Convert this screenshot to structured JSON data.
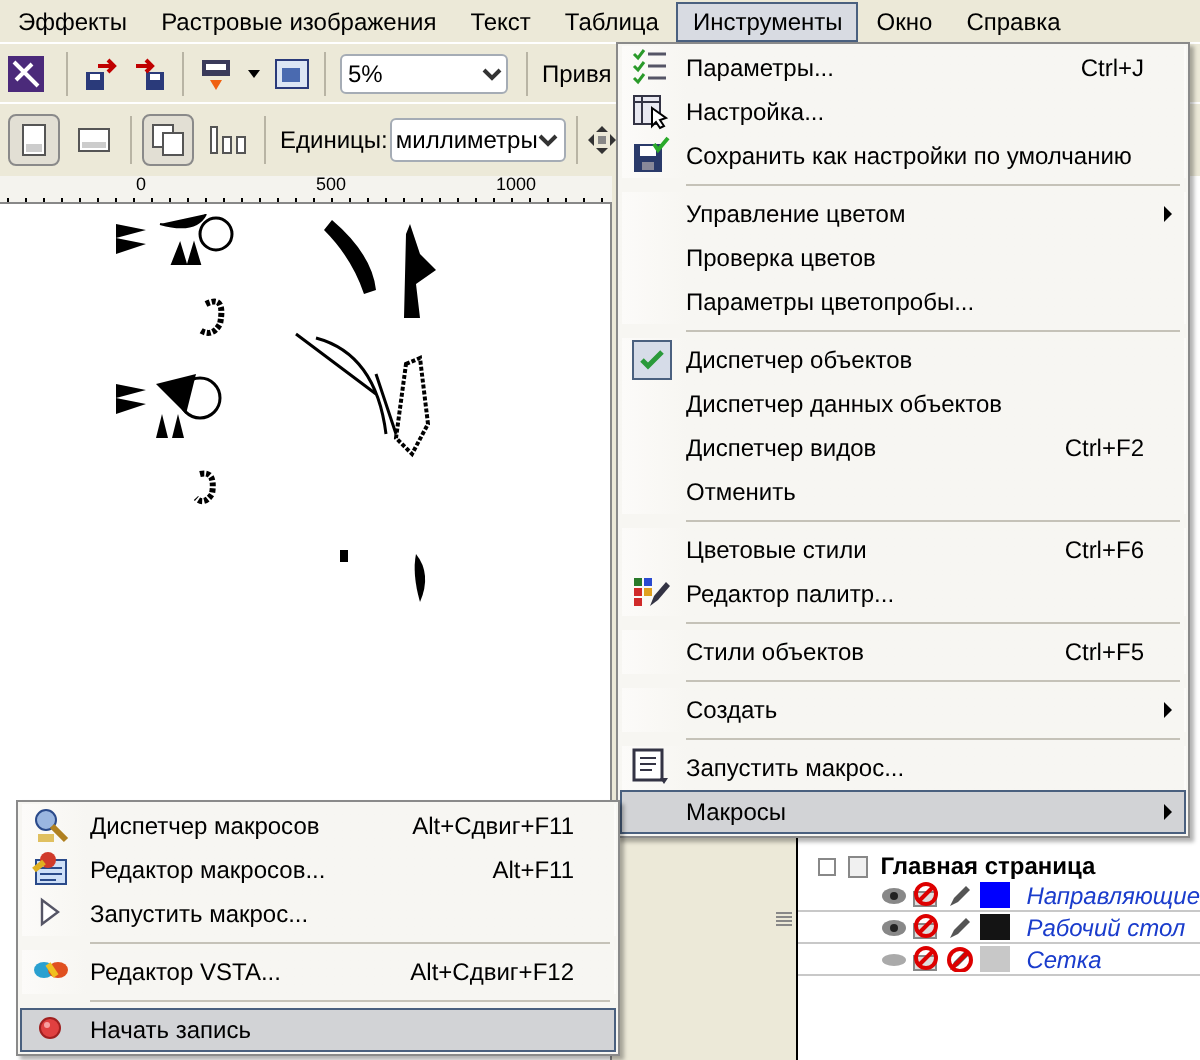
{
  "menubar": [
    {
      "label": "Эффекты",
      "selected": false
    },
    {
      "label": "Растровые изображения",
      "selected": false
    },
    {
      "label": "Текст",
      "selected": false
    },
    {
      "label": "Таблица",
      "selected": false
    },
    {
      "label": "Инструменты",
      "selected": true
    },
    {
      "label": "Окно",
      "selected": false
    },
    {
      "label": "Справка",
      "selected": false
    }
  ],
  "toolbar": {
    "zoom_combo": "5%",
    "snap_label": "Привя"
  },
  "property_bar": {
    "orientation_buttons": [
      {
        "selected": true
      },
      {
        "selected": false
      }
    ],
    "page_buttons": [
      {
        "selected": true
      },
      {
        "selected": false
      }
    ],
    "units_label": "Единицы:",
    "units_combo": "миллиметры"
  },
  "ruler": {
    "labels": [
      "0",
      "500",
      "1000"
    ]
  },
  "object_manager": {
    "page": "Главная страница",
    "layers": [
      {
        "name": "Направляющие",
        "color": "#0000ff",
        "visible": true,
        "editable": true
      },
      {
        "name": "Рабочий стол",
        "color": "#141414",
        "visible": true,
        "editable": true
      },
      {
        "name": "Сетка",
        "color": "#c8c8c8",
        "visible": false,
        "editable": false
      }
    ]
  },
  "tools_menu": {
    "items": [
      {
        "kind": "item",
        "label": "Параметры...",
        "shortcut": "Ctrl+J",
        "checked": false,
        "submenu": false,
        "selected": false
      },
      {
        "kind": "item",
        "label": "Настройка...",
        "checked": false,
        "submenu": false,
        "selected": false
      },
      {
        "kind": "item",
        "label": "Сохранить как настройки по умолчанию",
        "checked": false,
        "submenu": false,
        "selected": false
      },
      {
        "kind": "separator"
      },
      {
        "kind": "item",
        "label": "Управление цветом",
        "checked": false,
        "submenu": true,
        "selected": false
      },
      {
        "kind": "item",
        "label": "Проверка цветов",
        "checked": false,
        "submenu": false,
        "selected": false
      },
      {
        "kind": "item",
        "label": "Параметры цветопробы...",
        "checked": false,
        "submenu": false,
        "selected": false
      },
      {
        "kind": "separator"
      },
      {
        "kind": "item",
        "label": "Диспетчер объектов",
        "checked": true,
        "submenu": false,
        "selected": false
      },
      {
        "kind": "item",
        "label": "Диспетчер данных объектов",
        "checked": false,
        "submenu": false,
        "selected": false
      },
      {
        "kind": "item",
        "label": "Диспетчер видов",
        "shortcut": "Ctrl+F2",
        "checked": false,
        "submenu": false,
        "selected": false
      },
      {
        "kind": "item",
        "label": "Отменить",
        "checked": false,
        "submenu": false,
        "selected": false
      },
      {
        "kind": "separator"
      },
      {
        "kind": "item",
        "label": "Цветовые стили",
        "shortcut": "Ctrl+F6",
        "checked": false,
        "submenu": false,
        "selected": false
      },
      {
        "kind": "item",
        "label": "Редактор палитр...",
        "checked": false,
        "submenu": false,
        "selected": false
      },
      {
        "kind": "separator"
      },
      {
        "kind": "item",
        "label": "Стили объектов",
        "shortcut": "Ctrl+F5",
        "checked": false,
        "submenu": false,
        "selected": false
      },
      {
        "kind": "separator"
      },
      {
        "kind": "item",
        "label": "Создать",
        "checked": false,
        "submenu": true,
        "selected": false
      },
      {
        "kind": "separator"
      },
      {
        "kind": "item",
        "label": "Запустить макрос...",
        "checked": false,
        "submenu": false,
        "selected": false
      },
      {
        "kind": "item",
        "label": "Макросы",
        "checked": false,
        "submenu": true,
        "selected": true
      }
    ]
  },
  "macros_menu": {
    "items": [
      {
        "kind": "item",
        "label": "Диспетчер макросов",
        "shortcut": "Alt+Сдвиг+F11",
        "selected": false
      },
      {
        "kind": "item",
        "label": "Редактор макросов...",
        "shortcut": "Alt+F11",
        "selected": false
      },
      {
        "kind": "item",
        "label": "Запустить макрос...",
        "selected": false
      },
      {
        "kind": "separator"
      },
      {
        "kind": "item",
        "label": "Редактор VSTA...",
        "shortcut": "Alt+Сдвиг+F12",
        "selected": false
      },
      {
        "kind": "separator"
      },
      {
        "kind": "item",
        "label": "Начать запись",
        "selected": true
      }
    ]
  }
}
